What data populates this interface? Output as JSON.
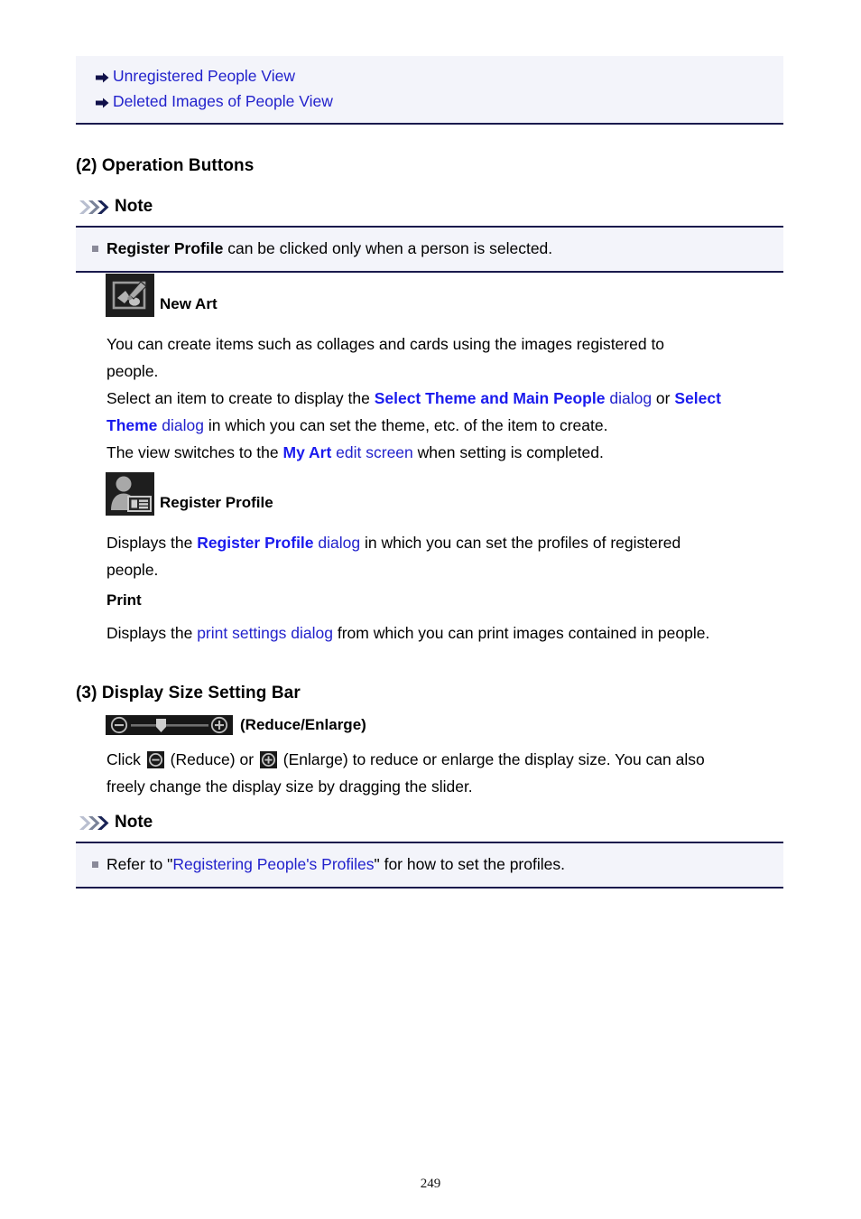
{
  "document": {
    "page_number": "249"
  },
  "top_links": {
    "items": [
      {
        "icon": "arrow-right-icon",
        "label": "Unregistered People View"
      },
      {
        "icon": "arrow-right-icon",
        "label": "Deleted Images of People View"
      }
    ]
  },
  "section_operation_buttons": {
    "heading": "(2) Operation Buttons",
    "note": {
      "icon": "triple-chevron-icon",
      "title": "Note",
      "items": [
        {
          "bold_lead": "Register Profile",
          "rest": " can be clicked only when a person is selected."
        }
      ]
    },
    "new_art": {
      "icon": "new-art-icon",
      "caption": "New Art",
      "lines": [
        [
          {
            "t": "You can create items such as collages and cards using the images registered to",
            "s": "plain"
          }
        ],
        [
          {
            "t": "people.",
            "s": "plain"
          }
        ],
        [
          {
            "t": "Select an item to create to display the ",
            "s": "plain"
          },
          {
            "t": "Select Theme and Main People",
            "s": "link-bold"
          },
          {
            "t": " dialog",
            "s": "link"
          },
          {
            "t": " or ",
            "s": "plain"
          },
          {
            "t": "Select",
            "s": "link-bold"
          }
        ],
        [
          {
            "t": "Theme",
            "s": "link-bold"
          },
          {
            "t": " dialog",
            "s": "link"
          },
          {
            "t": " in which you can set the theme, etc. of the item to create.",
            "s": "plain"
          }
        ],
        [
          {
            "t": "The view switches to the ",
            "s": "plain"
          },
          {
            "t": "My Art",
            "s": "link-bold"
          },
          {
            "t": " edit screen",
            "s": "link"
          },
          {
            "t": " when setting is completed.",
            "s": "plain"
          }
        ]
      ]
    },
    "register_profile": {
      "icon": "register-profile-icon",
      "caption": "Register Profile",
      "lines": [
        [
          {
            "t": "Displays the ",
            "s": "plain"
          },
          {
            "t": "Register Profile",
            "s": "link-bold"
          },
          {
            "t": " dialog",
            "s": "link"
          },
          {
            "t": " in which you can set the profiles of registered",
            "s": "plain"
          }
        ],
        [
          {
            "t": "people.",
            "s": "plain"
          }
        ]
      ]
    },
    "print": {
      "heading": "Print",
      "lines": [
        [
          {
            "t": "Displays the ",
            "s": "plain"
          },
          {
            "t": "print settings dialog",
            "s": "link"
          },
          {
            "t": " from which you can print images contained in people.",
            "s": "plain"
          }
        ]
      ]
    }
  },
  "section_display_size": {
    "heading": "(3) Display Size Setting Bar",
    "slider": {
      "icon": "display-size-slider-icon",
      "caption": "(Reduce/Enlarge)"
    },
    "lines": [
      [
        {
          "t": "Click ",
          "s": "plain"
        },
        {
          "t": "",
          "s": "icon-reduce"
        },
        {
          "t": " (Reduce) or ",
          "s": "plain"
        },
        {
          "t": "",
          "s": "icon-enlarge"
        },
        {
          "t": " (Enlarge) to reduce or enlarge the display size. You can also",
          "s": "plain"
        }
      ],
      [
        {
          "t": "freely change the display size by dragging the slider.",
          "s": "plain"
        }
      ]
    ],
    "note": {
      "icon": "triple-chevron-icon",
      "title": "Note",
      "items": [
        {
          "pre": "Refer to \"",
          "link": "Registering People's Profiles",
          "post": "\" for how to set the profiles."
        }
      ]
    }
  },
  "colors": {
    "link": "#2222cc",
    "link_bold": "#1a1aee",
    "note_bg": "#f3f4fa",
    "note_border": "#1a1a4d",
    "icon_dark": "#1e1e1e",
    "icon_gray": "#a8a8a8"
  }
}
